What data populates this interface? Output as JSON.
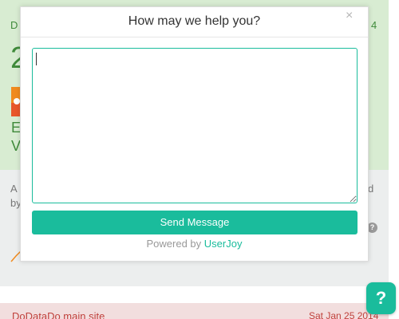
{
  "modal": {
    "title": "How may we help you?",
    "close_glyph": "×",
    "message_value": "",
    "send_label": "Send Message",
    "powered_by_label": "Powered by",
    "powered_by_brand": "UserJoy"
  },
  "background": {
    "green_fragment_left": "D",
    "green_fragment_right": "4",
    "green_big_value": "2",
    "green_line1": "E",
    "green_line2": "V",
    "gray_fragment_line1": "A",
    "gray_fragment_line2": "by",
    "gray_fragment_right1": "d",
    "gray_fragment_right2": "",
    "help_icon_glyph": "?",
    "red_site_name": "DoDataDo main site",
    "red_date": "Sat Jan 25 2014"
  },
  "help_button": {
    "glyph": "?"
  },
  "colors": {
    "accent": "#1abc9c",
    "success_bg": "#d8ecd2",
    "danger_bg": "#f2dede",
    "neutral_bg": "#eceeee"
  }
}
